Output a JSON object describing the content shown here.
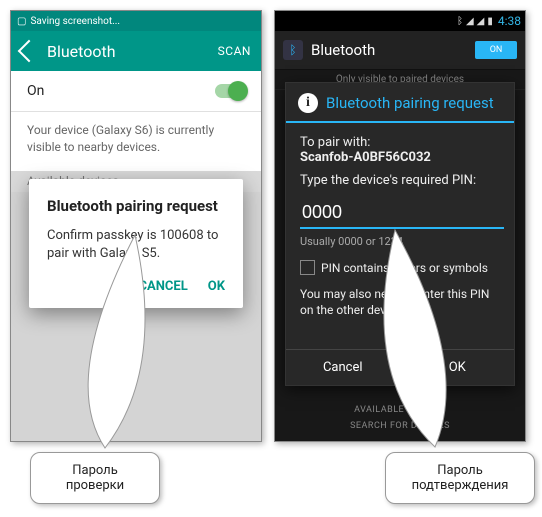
{
  "phone1": {
    "status_text": "Saving screenshot...",
    "appbar": {
      "back_icon": "arrow-back",
      "title": "Bluetooth",
      "scan": "SCAN"
    },
    "bt_row": {
      "label": "On",
      "state": "on"
    },
    "visibility_text": "Your device (Galaxy S6) is currently visible to nearby devices.",
    "section_header": "Available devices",
    "dialog": {
      "title": "Bluetooth pairing request",
      "body": "Confirm passkey is 100608 to pair with Galaxy S5.",
      "cancel": "CANCEL",
      "ok": "OK"
    }
  },
  "phone2": {
    "status": {
      "time": "4:38"
    },
    "appbar": {
      "title": "Bluetooth",
      "on_label": "ON"
    },
    "hint": "Only visible to paired devices",
    "dialog": {
      "title": "Bluetooth pairing request",
      "pair_label": "To pair with:",
      "pair_device": "Scanfob-A0BF56C032",
      "pin_prompt": "Type the device's required PIN:",
      "pin_value": "0000",
      "usually": "Usually 0000 or 1234",
      "checkbox_label": "PIN contains letters or symbols",
      "note": "You may also need to enter this PIN on the other device.",
      "cancel": "Cancel",
      "ok": "OK"
    },
    "footer": {
      "avail": "AVAILABLE DEVICES",
      "search": "SEARCH FOR DEVICES"
    }
  },
  "callouts": {
    "left": "Пароль проверки",
    "right": "Пароль подтверждения"
  }
}
